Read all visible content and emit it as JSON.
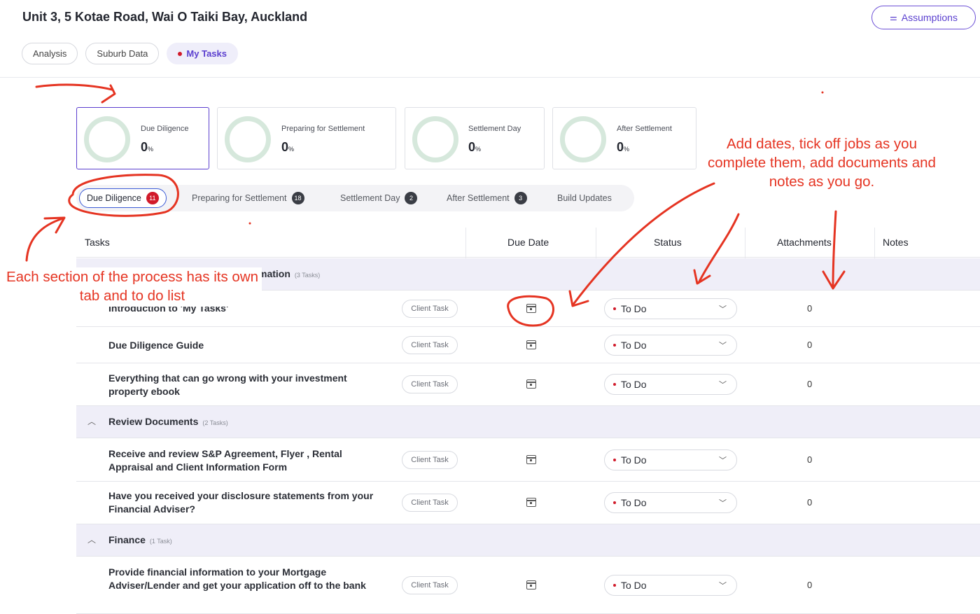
{
  "header": {
    "title": "Unit 3, 5 Kotae Road, Wai O Taiki Bay, Auckland",
    "assumptions_label": "Assumptions"
  },
  "topnav": {
    "tabs": [
      {
        "label": "Analysis"
      },
      {
        "label": "Suburb Data"
      },
      {
        "label": "My Tasks"
      }
    ]
  },
  "stages": [
    {
      "label": "Due Diligence",
      "percent": "0"
    },
    {
      "label": "Preparing for Settlement",
      "percent": "0"
    },
    {
      "label": "Settlement Day",
      "percent": "0"
    },
    {
      "label": "After Settlement",
      "percent": "0"
    }
  ],
  "percent_sign": "%",
  "subtabs": [
    {
      "label": "Due Diligence",
      "count": "11"
    },
    {
      "label": "Preparing for Settlement",
      "count": "18"
    },
    {
      "label": "Settlement Day",
      "count": "2"
    },
    {
      "label": "After Settlement",
      "count": "3"
    },
    {
      "label": "Build Updates"
    }
  ],
  "table": {
    "headers": {
      "tasks": "Tasks",
      "due_date": "Due Date",
      "status": "Status",
      "attachments": "Attachments",
      "notes": "Notes"
    },
    "groups": [
      {
        "name": "mation",
        "count": "(3 Tasks)",
        "tasks": [
          {
            "name": "Introduction to 'My Tasks'",
            "tag": "Client Task",
            "status": "To Do",
            "attachments": "0"
          },
          {
            "name": "Due Diligence Guide",
            "tag": "Client Task",
            "status": "To Do",
            "attachments": "0"
          },
          {
            "name": "Everything that can go wrong with your investment property ebook",
            "tag": "Client Task",
            "status": "To Do",
            "attachments": "0"
          }
        ]
      },
      {
        "name": "Review Documents",
        "count": "(2 Tasks)",
        "tasks": [
          {
            "name": "Receive and review S&P Agreement, Flyer , Rental Appraisal and Client Information Form",
            "tag": "Client Task",
            "status": "To Do",
            "attachments": "0"
          },
          {
            "name": "Have you received your disclosure statements from your Financial Adviser?",
            "tag": "Client Task",
            "status": "To Do",
            "attachments": "0"
          }
        ]
      },
      {
        "name": "Finance",
        "count": "(1 Task)",
        "tasks": [
          {
            "name": "Provide financial information to your Mortgage Adviser/Lender and get your application off to the bank",
            "tag": "Client Task",
            "status": "To Do",
            "attachments": "0"
          }
        ]
      }
    ]
  },
  "annotations": {
    "left": "Each section of the process has its own tab and to do list",
    "right": "Add dates, tick off jobs as you complete them, add documents and notes as you go."
  },
  "colors": {
    "accent": "#5b3fcf",
    "annotation": "#e53422",
    "status_dot": "#d11a2a",
    "ring": "#d6e8dc"
  }
}
